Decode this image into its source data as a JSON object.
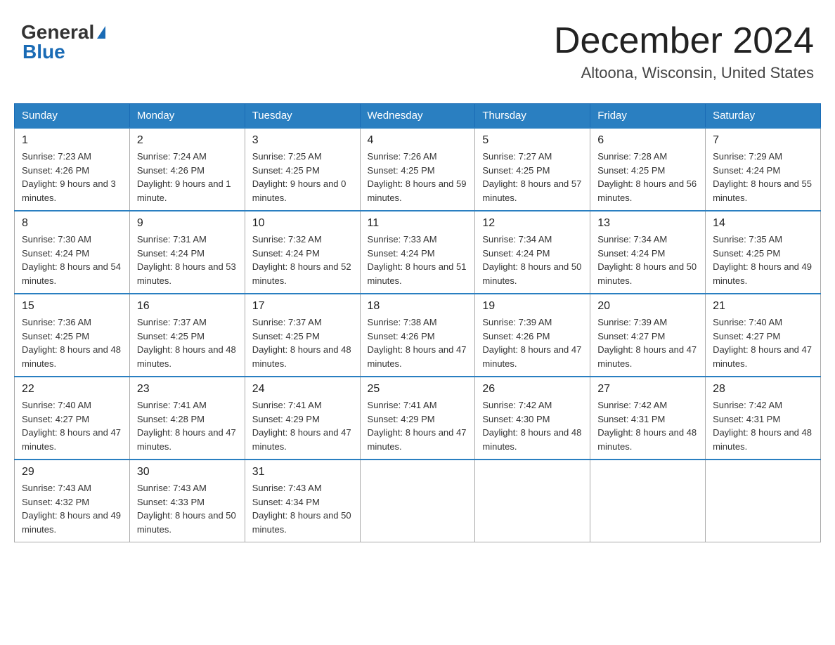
{
  "header": {
    "logo": {
      "text_general": "General",
      "text_blue": "Blue"
    },
    "month_title": "December 2024",
    "location": "Altoona, Wisconsin, United States"
  },
  "days_of_week": [
    "Sunday",
    "Monday",
    "Tuesday",
    "Wednesday",
    "Thursday",
    "Friday",
    "Saturday"
  ],
  "weeks": [
    [
      {
        "day": "1",
        "sunrise": "Sunrise: 7:23 AM",
        "sunset": "Sunset: 4:26 PM",
        "daylight": "Daylight: 9 hours and 3 minutes."
      },
      {
        "day": "2",
        "sunrise": "Sunrise: 7:24 AM",
        "sunset": "Sunset: 4:26 PM",
        "daylight": "Daylight: 9 hours and 1 minute."
      },
      {
        "day": "3",
        "sunrise": "Sunrise: 7:25 AM",
        "sunset": "Sunset: 4:25 PM",
        "daylight": "Daylight: 9 hours and 0 minutes."
      },
      {
        "day": "4",
        "sunrise": "Sunrise: 7:26 AM",
        "sunset": "Sunset: 4:25 PM",
        "daylight": "Daylight: 8 hours and 59 minutes."
      },
      {
        "day": "5",
        "sunrise": "Sunrise: 7:27 AM",
        "sunset": "Sunset: 4:25 PM",
        "daylight": "Daylight: 8 hours and 57 minutes."
      },
      {
        "day": "6",
        "sunrise": "Sunrise: 7:28 AM",
        "sunset": "Sunset: 4:25 PM",
        "daylight": "Daylight: 8 hours and 56 minutes."
      },
      {
        "day": "7",
        "sunrise": "Sunrise: 7:29 AM",
        "sunset": "Sunset: 4:24 PM",
        "daylight": "Daylight: 8 hours and 55 minutes."
      }
    ],
    [
      {
        "day": "8",
        "sunrise": "Sunrise: 7:30 AM",
        "sunset": "Sunset: 4:24 PM",
        "daylight": "Daylight: 8 hours and 54 minutes."
      },
      {
        "day": "9",
        "sunrise": "Sunrise: 7:31 AM",
        "sunset": "Sunset: 4:24 PM",
        "daylight": "Daylight: 8 hours and 53 minutes."
      },
      {
        "day": "10",
        "sunrise": "Sunrise: 7:32 AM",
        "sunset": "Sunset: 4:24 PM",
        "daylight": "Daylight: 8 hours and 52 minutes."
      },
      {
        "day": "11",
        "sunrise": "Sunrise: 7:33 AM",
        "sunset": "Sunset: 4:24 PM",
        "daylight": "Daylight: 8 hours and 51 minutes."
      },
      {
        "day": "12",
        "sunrise": "Sunrise: 7:34 AM",
        "sunset": "Sunset: 4:24 PM",
        "daylight": "Daylight: 8 hours and 50 minutes."
      },
      {
        "day": "13",
        "sunrise": "Sunrise: 7:34 AM",
        "sunset": "Sunset: 4:24 PM",
        "daylight": "Daylight: 8 hours and 50 minutes."
      },
      {
        "day": "14",
        "sunrise": "Sunrise: 7:35 AM",
        "sunset": "Sunset: 4:25 PM",
        "daylight": "Daylight: 8 hours and 49 minutes."
      }
    ],
    [
      {
        "day": "15",
        "sunrise": "Sunrise: 7:36 AM",
        "sunset": "Sunset: 4:25 PM",
        "daylight": "Daylight: 8 hours and 48 minutes."
      },
      {
        "day": "16",
        "sunrise": "Sunrise: 7:37 AM",
        "sunset": "Sunset: 4:25 PM",
        "daylight": "Daylight: 8 hours and 48 minutes."
      },
      {
        "day": "17",
        "sunrise": "Sunrise: 7:37 AM",
        "sunset": "Sunset: 4:25 PM",
        "daylight": "Daylight: 8 hours and 48 minutes."
      },
      {
        "day": "18",
        "sunrise": "Sunrise: 7:38 AM",
        "sunset": "Sunset: 4:26 PM",
        "daylight": "Daylight: 8 hours and 47 minutes."
      },
      {
        "day": "19",
        "sunrise": "Sunrise: 7:39 AM",
        "sunset": "Sunset: 4:26 PM",
        "daylight": "Daylight: 8 hours and 47 minutes."
      },
      {
        "day": "20",
        "sunrise": "Sunrise: 7:39 AM",
        "sunset": "Sunset: 4:27 PM",
        "daylight": "Daylight: 8 hours and 47 minutes."
      },
      {
        "day": "21",
        "sunrise": "Sunrise: 7:40 AM",
        "sunset": "Sunset: 4:27 PM",
        "daylight": "Daylight: 8 hours and 47 minutes."
      }
    ],
    [
      {
        "day": "22",
        "sunrise": "Sunrise: 7:40 AM",
        "sunset": "Sunset: 4:27 PM",
        "daylight": "Daylight: 8 hours and 47 minutes."
      },
      {
        "day": "23",
        "sunrise": "Sunrise: 7:41 AM",
        "sunset": "Sunset: 4:28 PM",
        "daylight": "Daylight: 8 hours and 47 minutes."
      },
      {
        "day": "24",
        "sunrise": "Sunrise: 7:41 AM",
        "sunset": "Sunset: 4:29 PM",
        "daylight": "Daylight: 8 hours and 47 minutes."
      },
      {
        "day": "25",
        "sunrise": "Sunrise: 7:41 AM",
        "sunset": "Sunset: 4:29 PM",
        "daylight": "Daylight: 8 hours and 47 minutes."
      },
      {
        "day": "26",
        "sunrise": "Sunrise: 7:42 AM",
        "sunset": "Sunset: 4:30 PM",
        "daylight": "Daylight: 8 hours and 48 minutes."
      },
      {
        "day": "27",
        "sunrise": "Sunrise: 7:42 AM",
        "sunset": "Sunset: 4:31 PM",
        "daylight": "Daylight: 8 hours and 48 minutes."
      },
      {
        "day": "28",
        "sunrise": "Sunrise: 7:42 AM",
        "sunset": "Sunset: 4:31 PM",
        "daylight": "Daylight: 8 hours and 48 minutes."
      }
    ],
    [
      {
        "day": "29",
        "sunrise": "Sunrise: 7:43 AM",
        "sunset": "Sunset: 4:32 PM",
        "daylight": "Daylight: 8 hours and 49 minutes."
      },
      {
        "day": "30",
        "sunrise": "Sunrise: 7:43 AM",
        "sunset": "Sunset: 4:33 PM",
        "daylight": "Daylight: 8 hours and 50 minutes."
      },
      {
        "day": "31",
        "sunrise": "Sunrise: 7:43 AM",
        "sunset": "Sunset: 4:34 PM",
        "daylight": "Daylight: 8 hours and 50 minutes."
      },
      null,
      null,
      null,
      null
    ]
  ]
}
